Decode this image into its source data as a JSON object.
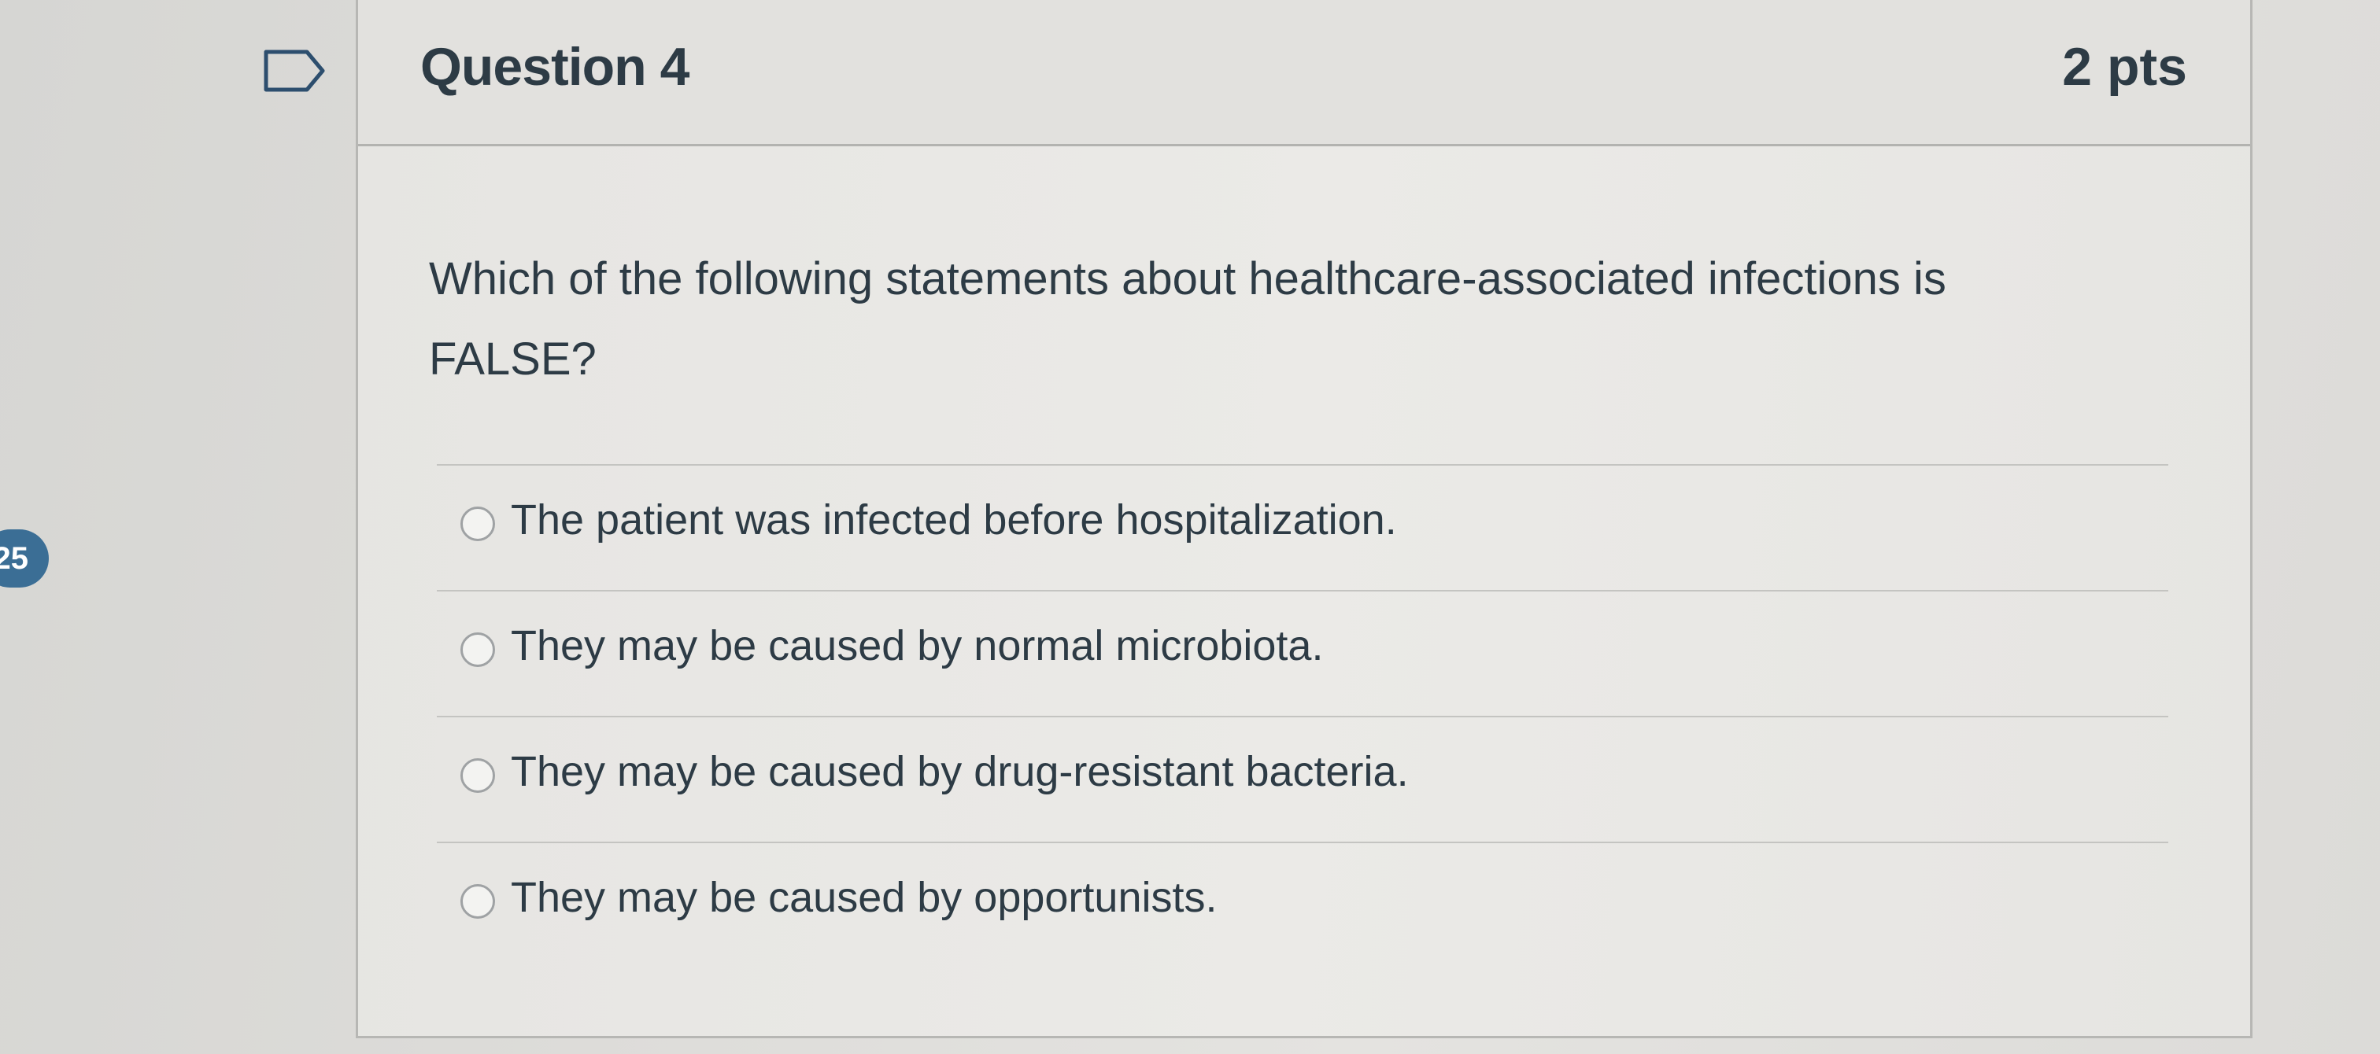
{
  "sidebar": {
    "page_number": "25"
  },
  "question": {
    "title": "Question 4",
    "points": "2 pts",
    "text": "Which of the following statements about healthcare-associated infections is FALSE?",
    "options": [
      {
        "label": "The patient was infected before hospitalization."
      },
      {
        "label": "They may be caused by normal microbiota."
      },
      {
        "label": "They may be caused by drug-resistant bacteria."
      },
      {
        "label": "They may be caused by opportunists."
      }
    ]
  },
  "icons": {
    "flag": "flag-outline-icon",
    "radio": "radio-unselected-icon"
  },
  "colors": {
    "badge": "#3b6e95",
    "text": "#2d3b45",
    "border": "#b7b7b4"
  }
}
